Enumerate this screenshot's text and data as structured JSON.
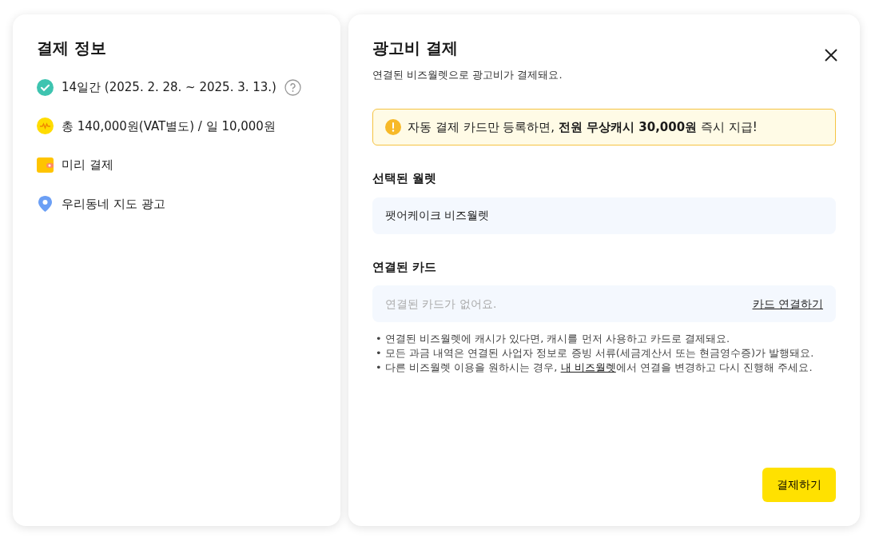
{
  "summary": {
    "title": "결제 정보",
    "items": [
      {
        "kind": "period",
        "text": "14일간 (2025. 2. 28. ~ 2025. 3. 13.)",
        "help": true
      },
      {
        "kind": "price",
        "text": "총 140,000원(VAT별도) / 일 10,000원",
        "help": false
      },
      {
        "kind": "payment",
        "text": "미리 결제",
        "help": false
      },
      {
        "kind": "location",
        "text": "우리동네 지도 광고",
        "help": false
      }
    ]
  },
  "payment": {
    "title": "광고비 결제",
    "subtitle": "연결된 비즈월렛으로 광고비가 결제돼요.",
    "notice": "자동 결제 카드만 등록하면, **전원 무상캐시 30,000원** 즉시 지급!",
    "wallet_label": "선택된 월렛",
    "wallet_value": "팻어케이크 비즈월렛",
    "card_label": "연결된 카드",
    "card_placeholder": "연결된 카드가 없어요.",
    "card_link": "카드 연결하기",
    "notes": [
      {
        "bullet": "•",
        "before": "연결된 비즈월렛에 캐시가 있다면, 캐시를 먼저 사용하고 카드로 결제돼요."
      },
      {
        "bullet": "•",
        "before": "모든 과금 내역은 연결된 사업자 정보로 증빙 서류(세금계산서 또는 현금영수증)가 발행돼요."
      },
      {
        "bullet": "•",
        "before": "다른 비즈월렛 이용을 원하시는 경우, ",
        "link": "내 비즈월렛",
        "after": "에서 연결을 변경하고 다시 진행해 주세요."
      }
    ],
    "submit": "결제하기"
  }
}
